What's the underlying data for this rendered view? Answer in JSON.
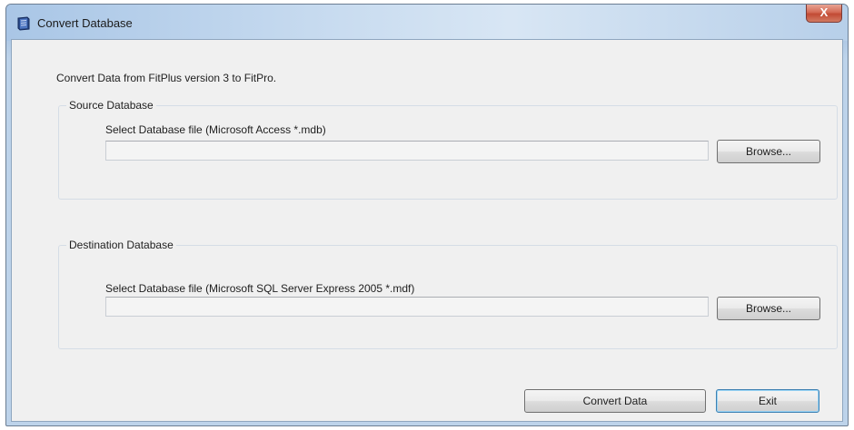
{
  "window": {
    "title": "Convert Database",
    "close_label": "X"
  },
  "intro_text": "Convert Data from FitPlus version 3 to FitPro.",
  "source": {
    "group_label": "Source Database",
    "field_label": "Select Database file (Microsoft Access *.mdb)",
    "path_value": "",
    "browse_label": "Browse..."
  },
  "destination": {
    "group_label": "Destination Database",
    "field_label": "Select Database file (Microsoft SQL Server Express 2005 *.mdf)",
    "path_value": "",
    "browse_label": "Browse..."
  },
  "actions": {
    "convert_label": "Convert Data",
    "exit_label": "Exit"
  },
  "icons": {
    "app": "database-icon",
    "close": "close-icon"
  }
}
